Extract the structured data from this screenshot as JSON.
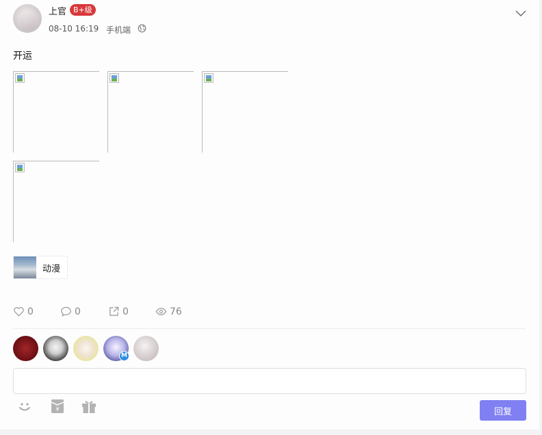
{
  "post": {
    "author": {
      "name": "上官",
      "level_badge": "B+级"
    },
    "timestamp": "08-10 16:19",
    "source": "手机端",
    "content": "开运",
    "images_count": 4,
    "tag": {
      "label": "动漫"
    }
  },
  "stats": {
    "likes": "0",
    "comments": "0",
    "shares": "0",
    "views": "76"
  },
  "visitors": [
    {
      "icon": "user-avatar"
    },
    {
      "icon": "user-avatar"
    },
    {
      "icon": "user-avatar"
    },
    {
      "icon": "user-avatar",
      "badge": "M"
    },
    {
      "icon": "user-avatar"
    }
  ],
  "reply": {
    "input_value": "",
    "button_label": "回复"
  },
  "colors": {
    "badge_red": "#d8383a",
    "button_purple": "#8080f2",
    "m_badge_blue": "#2f8de4"
  },
  "icons": {
    "header": [
      "globe-icon",
      "chevron-down-icon"
    ],
    "stats": [
      "heart-icon",
      "comment-icon",
      "share-icon",
      "eye-icon"
    ],
    "toolbar": [
      "emoji-icon",
      "red-envelope-icon",
      "gift-icon"
    ]
  }
}
